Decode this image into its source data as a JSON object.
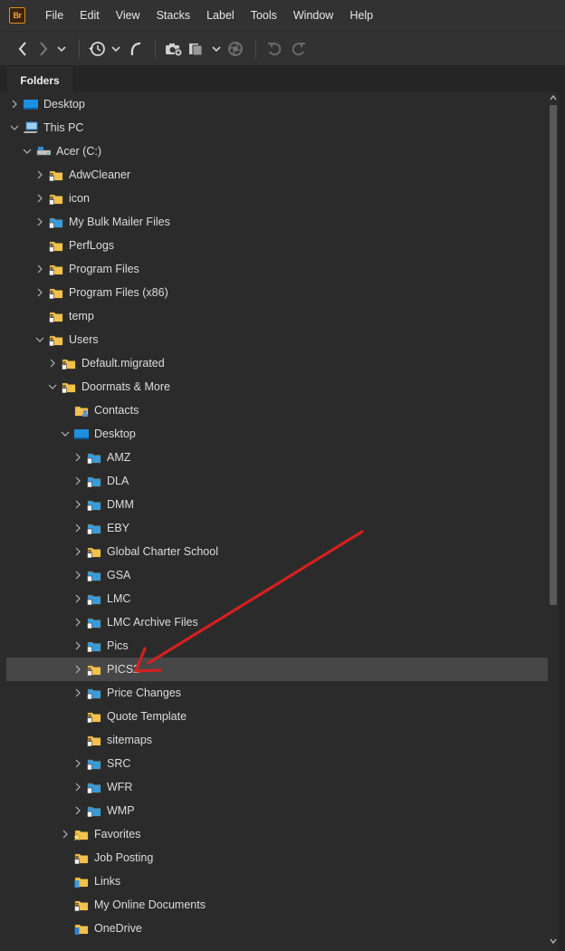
{
  "app": {
    "logo_text": "Br",
    "logo_color": "#e08a1e"
  },
  "menu": [
    "File",
    "Edit",
    "View",
    "Stacks",
    "Label",
    "Tools",
    "Window",
    "Help"
  ],
  "toolbar": {
    "buttons": [
      "back-icon",
      "forward-icon",
      "dropdown-icon",
      "recent-icon",
      "dropdown-icon",
      "boomerang-icon",
      "camera-icon",
      "copy-icon",
      "dropdown-icon",
      "refine-icon",
      "rotate-left-icon",
      "rotate-right-icon"
    ]
  },
  "panel": {
    "tab_label": "Folders"
  },
  "colors": {
    "folder_yellow": "#f2c14e",
    "folder_blue": "#3a9bd9",
    "selection": "#474747",
    "arrow_red": "#d42020"
  },
  "tree": [
    {
      "label": "Desktop",
      "level": 0,
      "expander": "collapsed",
      "icon": "desktop-icon"
    },
    {
      "label": "This PC",
      "level": 0,
      "expander": "expanded",
      "icon": "computer-icon"
    },
    {
      "label": "Acer (C:)",
      "level": 1,
      "expander": "expanded",
      "icon": "drive-icon"
    },
    {
      "label": "AdwCleaner",
      "level": 2,
      "expander": "collapsed",
      "icon": "locked-folder-icon"
    },
    {
      "label": "icon",
      "level": 2,
      "expander": "collapsed",
      "icon": "locked-folder-icon"
    },
    {
      "label": "My Bulk Mailer Files",
      "level": 2,
      "expander": "collapsed",
      "icon": "blue-folder-icon"
    },
    {
      "label": "PerfLogs",
      "level": 2,
      "expander": "none",
      "icon": "locked-folder-icon"
    },
    {
      "label": "Program Files",
      "level": 2,
      "expander": "collapsed",
      "icon": "locked-folder-icon"
    },
    {
      "label": "Program Files (x86)",
      "level": 2,
      "expander": "collapsed",
      "icon": "locked-folder-icon"
    },
    {
      "label": "temp",
      "level": 2,
      "expander": "none",
      "icon": "locked-folder-icon"
    },
    {
      "label": "Users",
      "level": 2,
      "expander": "expanded",
      "icon": "locked-folder-icon"
    },
    {
      "label": "Default.migrated",
      "level": 3,
      "expander": "collapsed",
      "icon": "locked-folder-icon"
    },
    {
      "label": "Doormats & More",
      "level": 3,
      "expander": "expanded",
      "icon": "locked-folder-icon"
    },
    {
      "label": "Contacts",
      "level": 4,
      "expander": "none",
      "icon": "contacts-folder-icon"
    },
    {
      "label": "Desktop",
      "level": 4,
      "expander": "expanded",
      "icon": "desktop-icon"
    },
    {
      "label": "AMZ",
      "level": 5,
      "expander": "collapsed",
      "icon": "blue-folder-icon"
    },
    {
      "label": "DLA",
      "level": 5,
      "expander": "collapsed",
      "icon": "blue-folder-icon"
    },
    {
      "label": "DMM",
      "level": 5,
      "expander": "collapsed",
      "icon": "blue-folder-icon"
    },
    {
      "label": "EBY",
      "level": 5,
      "expander": "collapsed",
      "icon": "blue-folder-icon"
    },
    {
      "label": "Global Charter School",
      "level": 5,
      "expander": "collapsed",
      "icon": "locked-folder-icon"
    },
    {
      "label": "GSA",
      "level": 5,
      "expander": "collapsed",
      "icon": "blue-folder-icon"
    },
    {
      "label": "LMC",
      "level": 5,
      "expander": "collapsed",
      "icon": "blue-folder-icon"
    },
    {
      "label": "LMC Archive Files",
      "level": 5,
      "expander": "collapsed",
      "icon": "blue-folder-icon"
    },
    {
      "label": "Pics",
      "level": 5,
      "expander": "collapsed",
      "icon": "blue-folder-icon"
    },
    {
      "label": "PICS2",
      "level": 5,
      "expander": "collapsed",
      "icon": "locked-folder-icon",
      "selected": true
    },
    {
      "label": "Price Changes",
      "level": 5,
      "expander": "collapsed",
      "icon": "blue-folder-icon"
    },
    {
      "label": "Quote Template",
      "level": 5,
      "expander": "none",
      "icon": "locked-folder-icon"
    },
    {
      "label": "sitemaps",
      "level": 5,
      "expander": "none",
      "icon": "locked-folder-icon"
    },
    {
      "label": "SRC",
      "level": 5,
      "expander": "collapsed",
      "icon": "blue-folder-icon"
    },
    {
      "label": "WFR",
      "level": 5,
      "expander": "collapsed",
      "icon": "blue-folder-icon"
    },
    {
      "label": "WMP",
      "level": 5,
      "expander": "collapsed",
      "icon": "blue-folder-icon"
    },
    {
      "label": "Favorites",
      "level": 4,
      "expander": "collapsed",
      "icon": "favorites-folder-icon"
    },
    {
      "label": "Job Posting",
      "level": 4,
      "expander": "none",
      "icon": "locked-folder-icon"
    },
    {
      "label": "Links",
      "level": 4,
      "expander": "none",
      "icon": "links-folder-icon"
    },
    {
      "label": "My Online Documents",
      "level": 4,
      "expander": "none",
      "icon": "locked-folder-icon"
    },
    {
      "label": "OneDrive",
      "level": 4,
      "expander": "none",
      "icon": "onedrive-folder-icon"
    }
  ]
}
